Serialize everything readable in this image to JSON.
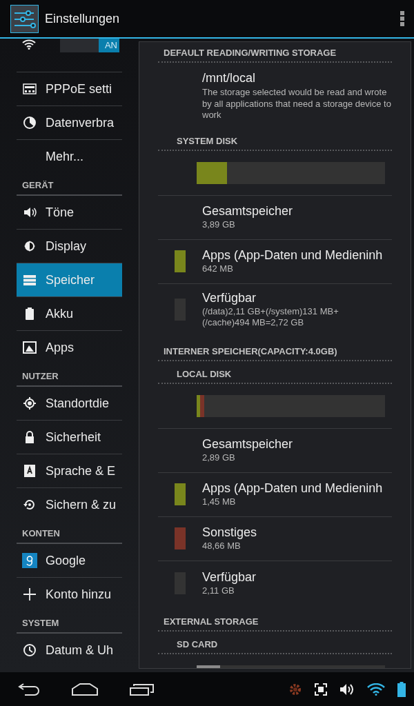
{
  "action_bar": {
    "title": "Einstellungen"
  },
  "sidebar": {
    "items": [
      {
        "kind": "toggle",
        "label": "AN",
        "on": true
      },
      {
        "kind": "item",
        "label": "PPPoE setti",
        "selected": false
      },
      {
        "kind": "item",
        "label": "Datenverbra",
        "selected": false
      },
      {
        "kind": "item",
        "label": "Mehr...",
        "selected": false
      },
      {
        "kind": "header",
        "label": "GERÄT"
      },
      {
        "kind": "item",
        "label": "Töne",
        "selected": false
      },
      {
        "kind": "item",
        "label": "Display",
        "selected": false
      },
      {
        "kind": "item",
        "label": "Speicher",
        "selected": true
      },
      {
        "kind": "item",
        "label": "Akku",
        "selected": false
      },
      {
        "kind": "item",
        "label": "Apps",
        "selected": false
      },
      {
        "kind": "header",
        "label": "NUTZER"
      },
      {
        "kind": "item",
        "label": "Standortdie",
        "selected": false
      },
      {
        "kind": "item",
        "label": "Sicherheit",
        "selected": false
      },
      {
        "kind": "item",
        "label": "Sprache & E",
        "selected": false
      },
      {
        "kind": "item",
        "label": "Sichern & zu",
        "selected": false
      },
      {
        "kind": "header",
        "label": "KONTEN"
      },
      {
        "kind": "item",
        "label": "Google",
        "selected": false
      },
      {
        "kind": "item",
        "label": "Konto hinzu",
        "selected": false
      },
      {
        "kind": "header",
        "label": "SYSTEM"
      },
      {
        "kind": "item",
        "label": "Datum & Uh",
        "selected": false
      }
    ]
  },
  "storage": {
    "rows": [
      {
        "kind": "header",
        "label": "DEFAULT READING/WRITING STORAGE"
      },
      {
        "kind": "option",
        "title": "/mnt/local",
        "summary": "The storage selected would be read and wrote by all applications that need a storage device to work"
      },
      {
        "kind": "subheader",
        "label": "SYSTEM DISK"
      },
      {
        "kind": "bar",
        "segments": [
          {
            "color": "#79861c",
            "level": 0.16
          }
        ]
      },
      {
        "kind": "entry",
        "title": "Gesamtspeicher",
        "value": "3,89 GB"
      },
      {
        "kind": "entry",
        "title": "Apps (App-Daten und Medieninh",
        "value": "642 MB",
        "color": "#79861c"
      },
      {
        "kind": "entry",
        "title": "Verfügbar",
        "value": "(/data)2,11 GB+(/system)131 MB+(/cache)494 MB=2,72 GB",
        "color": "#333333"
      },
      {
        "kind": "header",
        "label": "INTERNER SPEICHER(CAPACITY:4.0GB)"
      },
      {
        "kind": "subheader",
        "label": "LOCAL DISK"
      },
      {
        "kind": "bar",
        "segments": [
          {
            "color": "#79861c",
            "level": 0.02
          },
          {
            "color": "#7a3328",
            "level": 0.02
          }
        ]
      },
      {
        "kind": "entry",
        "title": "Gesamtspeicher",
        "value": "2,89 GB"
      },
      {
        "kind": "entry",
        "title": "Apps (App-Daten und Medieninh",
        "value": "1,45 MB",
        "color": "#79861c"
      },
      {
        "kind": "entry",
        "title": "Sonstiges",
        "value": "48,66 MB",
        "color": "#7a3328"
      },
      {
        "kind": "entry",
        "title": "Verfügbar",
        "value": "2,11 GB",
        "color": "#333333"
      },
      {
        "kind": "header",
        "label": "EXTERNAL STORAGE"
      },
      {
        "kind": "subheader",
        "label": "SD CARD"
      },
      {
        "kind": "bar",
        "segments": [
          {
            "color": "#8a8a8a",
            "level": 0.125
          }
        ]
      }
    ]
  }
}
